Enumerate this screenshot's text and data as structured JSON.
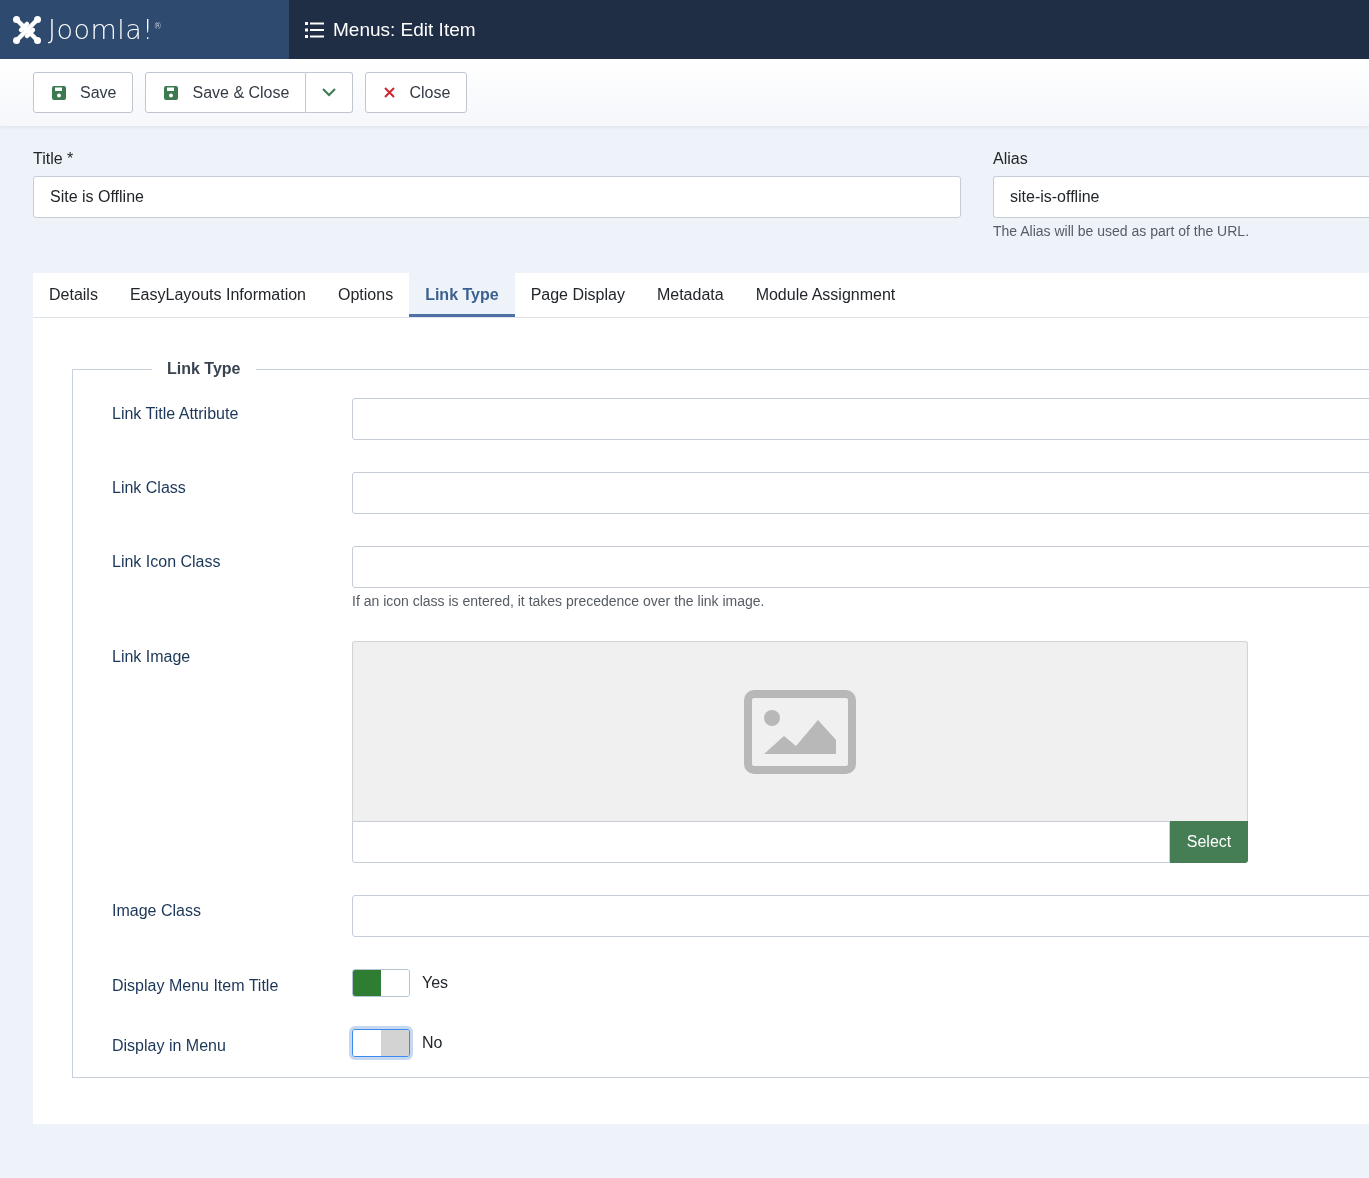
{
  "header": {
    "brand": "Joomla!$^{®}$",
    "title": "Menus: Edit Item"
  },
  "toolbar": {
    "buttons": [
      {
        "kind": "save",
        "label": "Save"
      },
      {
        "kind": "save-split",
        "label": "Save & Close"
      },
      {
        "kind": "close",
        "label": "Close"
      }
    ]
  },
  "title_field": {
    "label": "Title *",
    "value": "Site is Offline"
  },
  "alias_field": {
    "label": "Alias",
    "value": "site-is-offline",
    "hint": "The Alias will be used as part of the URL."
  },
  "tabs": [
    {
      "label": "Details",
      "selected": false
    },
    {
      "label": "EasyLayouts Information",
      "selected": false
    },
    {
      "label": "Options",
      "selected": false
    },
    {
      "label": "Link Type",
      "selected": true
    },
    {
      "label": "Page Display",
      "selected": false
    },
    {
      "label": "Metadata",
      "selected": false
    },
    {
      "label": "Module Assignment",
      "selected": false
    }
  ],
  "fieldset": {
    "legend": "Link Type",
    "fields": [
      {
        "kind": "text",
        "label": "Link Title Attribute"
      },
      {
        "kind": "text",
        "label": "Link Class"
      },
      {
        "kind": "text",
        "label": "Link Icon Class",
        "hint": "If an icon class is entered, it takes precedence over the link image."
      },
      {
        "kind": "media",
        "label": "Link Image",
        "button": "Select"
      },
      {
        "kind": "text",
        "label": "Image Class"
      },
      {
        "kind": "toggle",
        "label": "Display Menu Item Title",
        "on": true,
        "focused": false,
        "text": "Yes"
      },
      {
        "kind": "toggle",
        "label": "Display in Menu",
        "on": false,
        "focused": true,
        "text": "No"
      }
    ]
  }
}
